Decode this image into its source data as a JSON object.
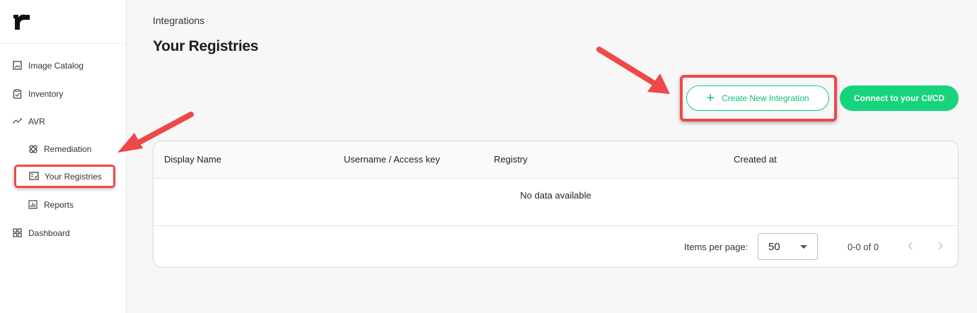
{
  "sidebar": {
    "items": [
      {
        "label": "Image Catalog",
        "icon": "image-icon"
      },
      {
        "label": "Inventory",
        "icon": "clipboard-check-icon"
      },
      {
        "label": "AVR",
        "icon": "trend-icon"
      },
      {
        "label": "Remediation",
        "icon": "bandage-icon"
      },
      {
        "label": "Your Registries",
        "icon": "registry-icon"
      },
      {
        "label": "Reports",
        "icon": "bar-chart-icon"
      },
      {
        "label": "Dashboard",
        "icon": "grid-icon"
      }
    ]
  },
  "header": {
    "breadcrumb": "Integrations",
    "title": "Your Registries"
  },
  "actions": {
    "create_label": "Create New Integration",
    "connect_label": "Connect to your CI/CD"
  },
  "table": {
    "columns": [
      "Display Name",
      "Username / Access key",
      "Registry",
      "Created at"
    ],
    "empty_text": "No data available",
    "items_per_page_label": "Items per page:",
    "items_per_page_value": "50",
    "range_text": "0-0 of 0"
  },
  "colors": {
    "accent": "#17d47c",
    "highlight": "#ef4848"
  }
}
